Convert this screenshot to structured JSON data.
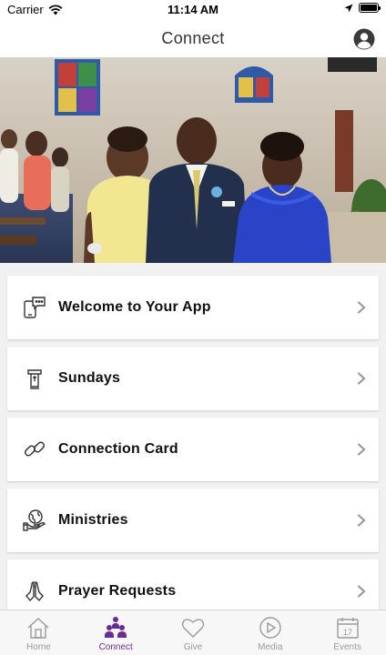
{
  "status_bar": {
    "carrier": "Carrier",
    "time": "11:14 AM"
  },
  "header": {
    "title": "Connect"
  },
  "menu": {
    "items": [
      {
        "label": "Welcome to Your App",
        "icon": "phone-chat-icon"
      },
      {
        "label": "Sundays",
        "icon": "pulpit-icon"
      },
      {
        "label": "Connection Card",
        "icon": "link-icon"
      },
      {
        "label": "Ministries",
        "icon": "globe-hand-icon"
      },
      {
        "label": "Prayer Requests",
        "icon": "praying-hands-icon"
      }
    ]
  },
  "tabs": [
    {
      "label": "Home",
      "icon": "home-icon",
      "active": false
    },
    {
      "label": "Connect",
      "icon": "people-icon",
      "active": true
    },
    {
      "label": "Give",
      "icon": "heart-icon",
      "active": false
    },
    {
      "label": "Media",
      "icon": "play-icon",
      "active": false
    },
    {
      "label": "Events",
      "icon": "calendar-icon",
      "active": false,
      "badge": "17"
    }
  ],
  "colors": {
    "accent": "#6a2b9a",
    "inactive_tab": "#9a9a9a",
    "background": "#f1f1f1"
  }
}
